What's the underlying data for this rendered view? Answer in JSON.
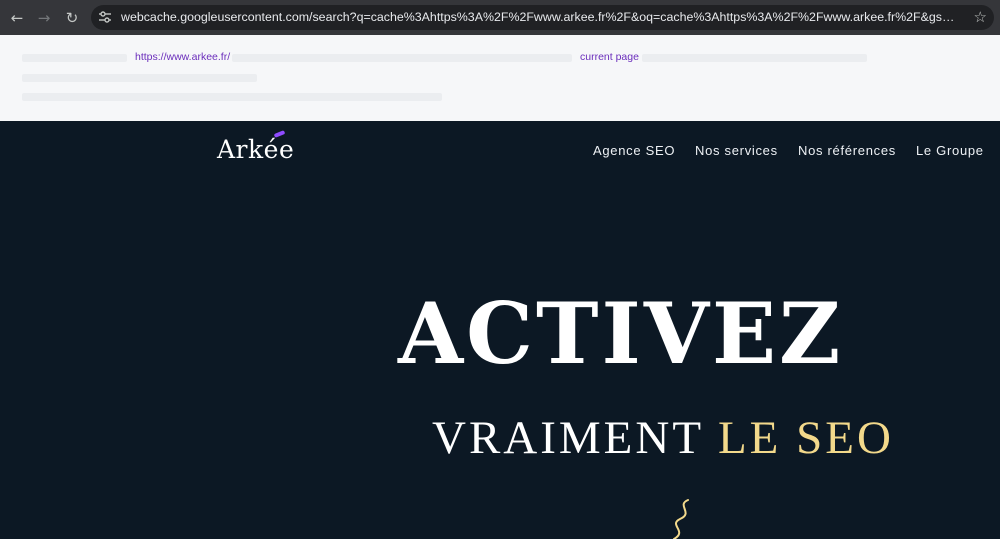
{
  "browser": {
    "url": "webcache.googleusercontent.com/search?q=cache%3Ahttps%3A%2F%2Fwww.arkee.fr%2F&oq=cache%3Ahttps%3A%2F%2Fwww.arkee.fr%2F&gs_lcrp=EgZjaH...",
    "back_icon": "arrow-left",
    "forward_icon": "arrow-right",
    "reload_icon": "reload",
    "site_info_icon": "tune",
    "bookmark_icon": "star"
  },
  "cache_banner": {
    "link_url": "https://www.arkee.fr/",
    "link_current": "current page"
  },
  "site": {
    "logo": "Arkée",
    "nav": [
      "Agence SEO",
      "Nos services",
      "Nos références",
      "Le Groupe"
    ],
    "hero_title": "ACTIVEZ",
    "hero_sub_plain": "VRAIMENT ",
    "hero_sub_highlight": "LE SEO",
    "colors": {
      "background": "#0c1824",
      "accent": "#f3d98b",
      "logo_accent": "#8f4bff",
      "link": "#6a2dbb"
    }
  }
}
